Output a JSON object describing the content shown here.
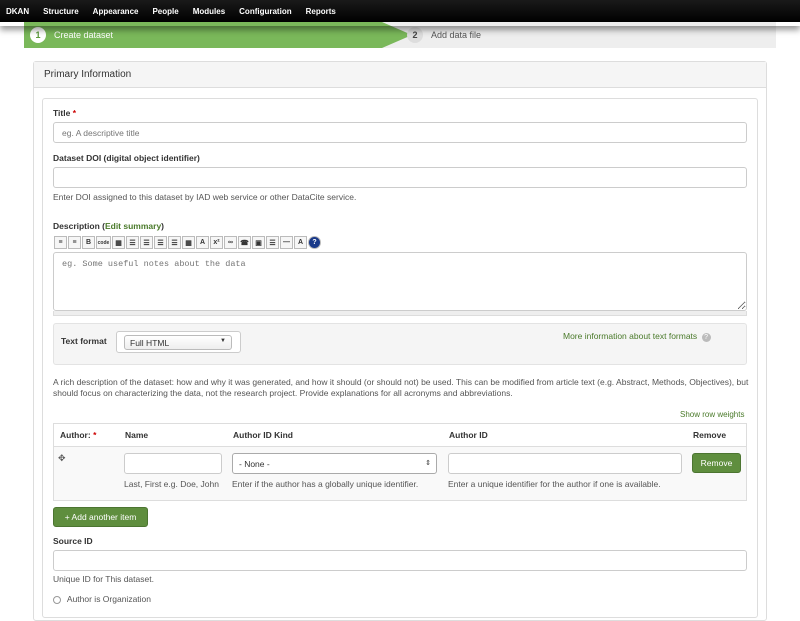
{
  "topnav": [
    "DKAN",
    "Structure",
    "Appearance",
    "People",
    "Modules",
    "Configuration",
    "Reports"
  ],
  "steps": [
    {
      "num": "1",
      "label": "Create dataset"
    },
    {
      "num": "2",
      "label": "Add data file"
    }
  ],
  "panel_title": "Primary Information",
  "title_field": {
    "label": "Title",
    "required": "*",
    "placeholder": "eg. A descriptive title"
  },
  "doi_field": {
    "label": "Dataset DOI (digital object identifier)",
    "help": "Enter DOI assigned to this dataset by IAD web service or other DataCite service."
  },
  "description": {
    "label": "Description (",
    "edit_summary": "Edit summary",
    "label_end": ")",
    "placeholder": "eg. Some useful notes about the data",
    "help": "A rich description of the dataset: how and why it was generated, and how it should (or should not) be used. This can be modified from article text (e.g. Abstract, Methods, Objectives), but should focus on characterizing the data, not the research project. Provide explanations for all acronyms and abbreviations."
  },
  "text_format": {
    "label": "Text format",
    "value": "Full HTML",
    "more_info": "More information about text formats"
  },
  "show_row_weights": "Show row weights",
  "author_table": {
    "headers": [
      "Author:",
      "Name",
      "Author ID Kind",
      "Author ID",
      "Remove"
    ],
    "required": "*",
    "id_kind_value": "- None -",
    "name_help": "Last, First e.g. Doe, John",
    "id_kind_help": "Enter if the author has a globally unique identifier.",
    "id_help": "Enter a unique identifier for the author if one is available.",
    "remove_label": "Remove"
  },
  "add_another": "+ Add another item",
  "source_id": {
    "label": "Source ID",
    "help": "Unique ID for This dataset."
  },
  "author_org": "Author is Organization"
}
